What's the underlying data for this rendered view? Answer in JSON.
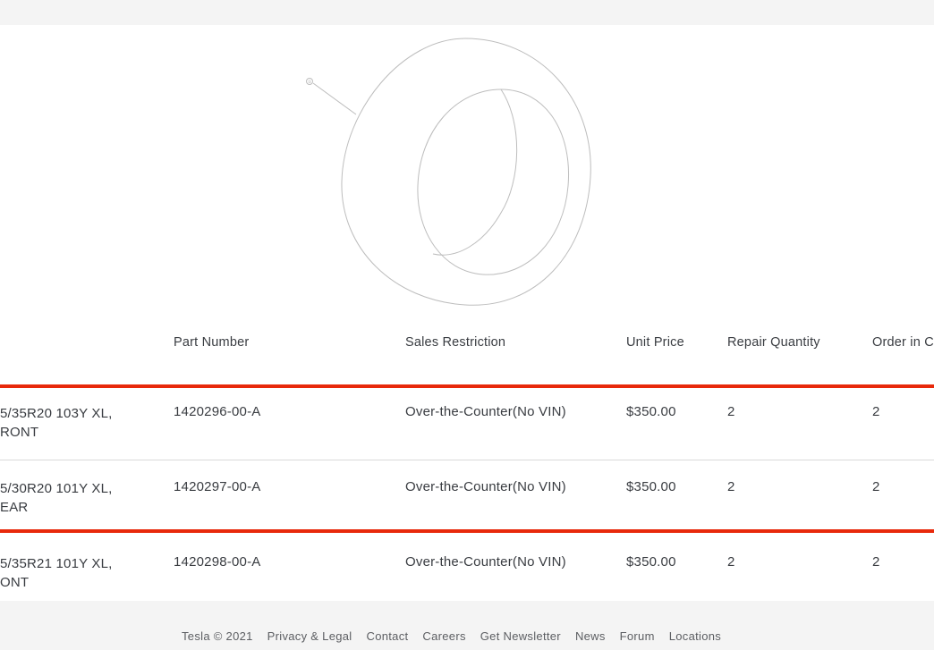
{
  "diagram": {
    "callout": "①"
  },
  "table": {
    "headers": {
      "part_number": "Part Number",
      "sales_restriction": "Sales Restriction",
      "unit_price": "Unit Price",
      "repair_quantity": "Repair Quantity",
      "order_in": "Order in C"
    },
    "rows": [
      {
        "desc_line1": "5/35R20 103Y XL,",
        "desc_line2": "RONT",
        "part_number": "1420296-00-A",
        "sales_restriction": "Over-the-Counter(No VIN)",
        "unit_price": "$350.00",
        "repair_quantity": "2",
        "order_in": "2"
      },
      {
        "desc_line1": "5/30R20 101Y XL,",
        "desc_line2": "EAR",
        "part_number": "1420297-00-A",
        "sales_restriction": "Over-the-Counter(No VIN)",
        "unit_price": "$350.00",
        "repair_quantity": "2",
        "order_in": "2"
      },
      {
        "desc_line1": "5/35R21 101Y XL,",
        "desc_line2": "ONT",
        "part_number": "1420298-00-A",
        "sales_restriction": "Over-the-Counter(No VIN)",
        "unit_price": "$350.00",
        "repair_quantity": "2",
        "order_in": "2"
      }
    ],
    "highlight_color": "#e8290b"
  },
  "footer": {
    "links": [
      "Tesla © 2021",
      "Privacy & Legal",
      "Contact",
      "Careers",
      "Get Newsletter",
      "News",
      "Forum",
      "Locations"
    ]
  }
}
